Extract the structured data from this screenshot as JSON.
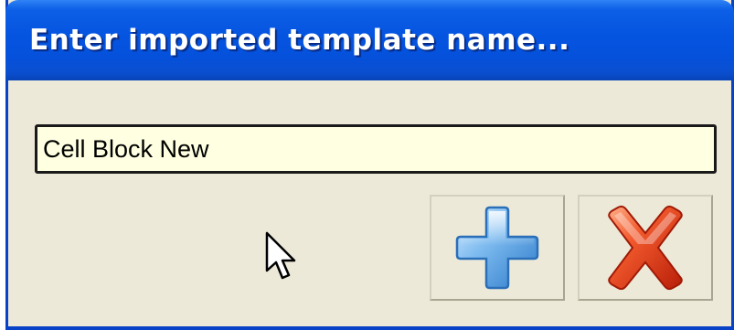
{
  "dialog": {
    "title": "Enter imported template name...",
    "name_input": {
      "value": "Cell Block New",
      "placeholder": ""
    },
    "buttons": {
      "add_icon": "plus-icon",
      "cancel_icon": "x-icon"
    }
  },
  "colors": {
    "titlebar": "#0554e0",
    "window_bg": "#ece9d8",
    "input_bg": "#ffffe1",
    "plus_blue": "#4a9de0",
    "x_red": "#e03820"
  }
}
